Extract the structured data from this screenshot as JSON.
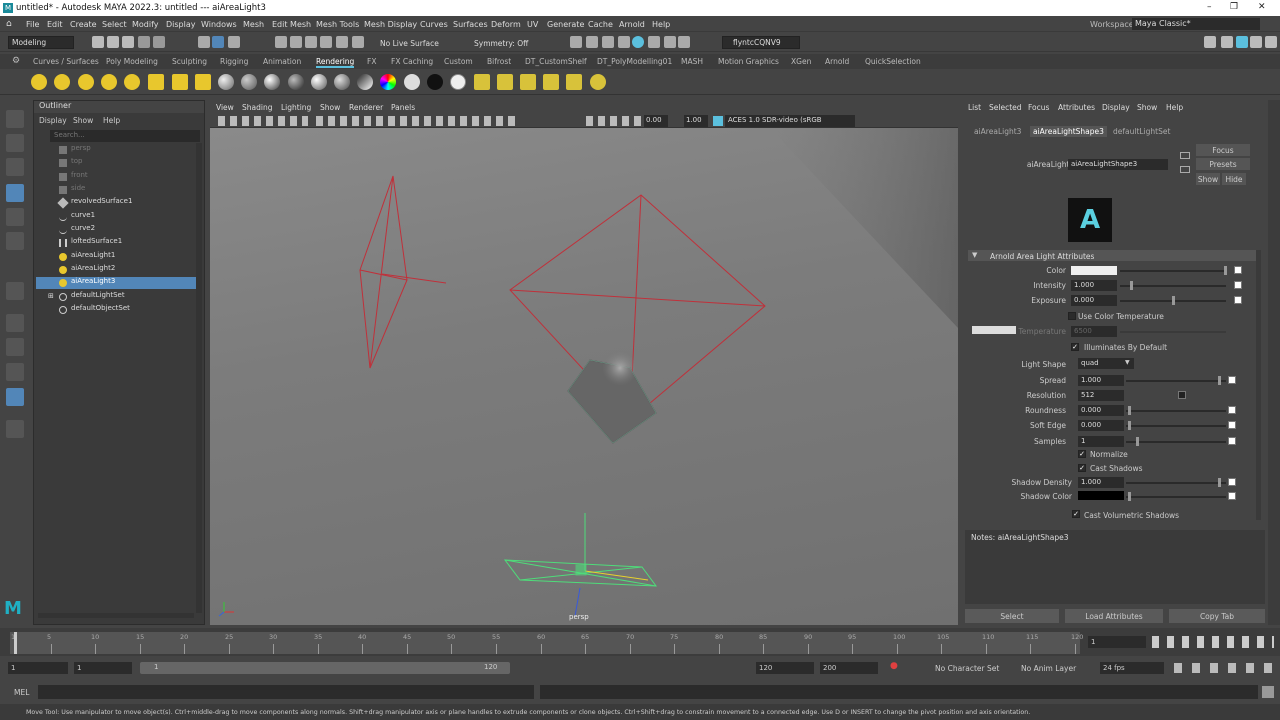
{
  "titlebar": {
    "title": "untitled* - Autodesk MAYA 2022.3: untitled  ---   aiAreaLight3"
  },
  "menubar": {
    "items": [
      "File",
      "Edit",
      "Create",
      "Select",
      "Modify",
      "Display",
      "Windows",
      "Mesh",
      "Edit Mesh",
      "Mesh Tools",
      "Mesh Display",
      "Curves",
      "Surfaces",
      "Deform",
      "UV",
      "Generate",
      "Cache",
      "Arnold",
      "Help"
    ],
    "workspace_label": "Workspace:",
    "workspace_value": "Maya Classic*"
  },
  "statusline": {
    "mode": "Modeling",
    "live_surface": "No Live Surface",
    "symmetry": "Symmetry: Off",
    "user": "flyntcCQNV9"
  },
  "shelf": {
    "tabs": [
      "Curves / Surfaces",
      "Poly Modeling",
      "Sculpting",
      "Rigging",
      "Animation",
      "Rendering",
      "FX",
      "FX Caching",
      "Custom",
      "Bifrost",
      "DT_CustomShelf",
      "DT_PolyModelling01",
      "MASH",
      "Motion Graphics",
      "XGen",
      "Arnold",
      "QuickSelection"
    ],
    "active_tab": "Rendering"
  },
  "outliner": {
    "title": "Outliner",
    "menu": [
      "Display",
      "Show",
      "Help"
    ],
    "search_placeholder": "Search...",
    "items": [
      {
        "label": "persp",
        "dim": true
      },
      {
        "label": "top",
        "dim": true
      },
      {
        "label": "front",
        "dim": true
      },
      {
        "label": "side",
        "dim": true
      },
      {
        "label": "revolvedSurface1"
      },
      {
        "label": "curve1"
      },
      {
        "label": "curve2"
      },
      {
        "label": "loftedSurface1"
      },
      {
        "label": "aiAreaLight1"
      },
      {
        "label": "aiAreaLight2"
      },
      {
        "label": "aiAreaLight3",
        "selected": true
      },
      {
        "label": "defaultLightSet"
      },
      {
        "label": "defaultObjectSet"
      }
    ]
  },
  "viewport": {
    "menu": [
      "View",
      "Shading",
      "Lighting",
      "Show",
      "Renderer",
      "Panels"
    ],
    "exposure": "0.00",
    "gamma": "1.00",
    "color_space": "ACES 1.0 SDR-video (sRGB",
    "camera": "persp"
  },
  "attribute_editor": {
    "menu": [
      "List",
      "Selected",
      "Focus",
      "Attributes",
      "Display",
      "Show",
      "Help"
    ],
    "tabs": [
      "aiAreaLight3",
      "aiAreaLightShape3",
      "defaultLightSet"
    ],
    "active_tab": "aiAreaLightShape3",
    "node_label": "aiAreaLight:",
    "node_value": "aiAreaLightShape3",
    "focus": "Focus",
    "presets": "Presets",
    "show": "Show",
    "hide": "Hide",
    "section": "Arnold Area Light Attributes",
    "color_label": "Color",
    "intensity_label": "Intensity",
    "intensity": "1.000",
    "exposure_label": "Exposure",
    "exposure": "0.000",
    "use_color_temp": "Use Color Temperature",
    "temperature_label": "Temperature",
    "temperature": "6500",
    "illuminates": "Illuminates By Default",
    "light_shape_label": "Light Shape",
    "light_shape": "quad",
    "spread_label": "Spread",
    "spread": "1.000",
    "resolution_label": "Resolution",
    "resolution": "512",
    "roundness_label": "Roundness",
    "roundness": "0.000",
    "soft_edge_label": "Soft Edge",
    "soft_edge": "0.000",
    "samples_label": "Samples",
    "samples": "1",
    "normalize": "Normalize",
    "cast_shadows": "Cast Shadows",
    "shadow_density_label": "Shadow Density",
    "shadow_density": "1.000",
    "shadow_color_label": "Shadow Color",
    "cast_vol_shadows": "Cast Volumetric Shadows",
    "notes": "Notes:  aiAreaLightShape3",
    "btn_select": "Select",
    "btn_load": "Load Attributes",
    "btn_copy": "Copy Tab"
  },
  "timeline": {
    "ticks": [
      "1",
      "5",
      "10",
      "15",
      "20",
      "25",
      "30",
      "35",
      "40",
      "45",
      "50",
      "55",
      "60",
      "65",
      "70",
      "75",
      "80",
      "85",
      "90",
      "95",
      "100",
      "105",
      "110",
      "115",
      "120"
    ],
    "current_frame": "1"
  },
  "range": {
    "start": "1",
    "inner_start": "1",
    "slider_start": "1",
    "slider_end": "120",
    "end": "120",
    "outer_end": "200",
    "character_set": "No Character Set",
    "anim_layer": "No Anim Layer",
    "fps": "24 fps"
  },
  "cmdline": {
    "label": "MEL"
  },
  "helpline": {
    "text": "Move Tool: Use manipulator to move object(s). Ctrl+middle-drag to move components along normals. Shift+drag manipulator axis or plane handles to extrude components or clone objects. Ctrl+Shift+drag to constrain movement to a connected edge. Use D or INSERT to change the pivot position and axis orientation."
  },
  "colors": {
    "accent": "#5bc0de",
    "selection": "#5286b8",
    "light_wire": "#c0303a",
    "manip_green": "#4fdc7a"
  }
}
